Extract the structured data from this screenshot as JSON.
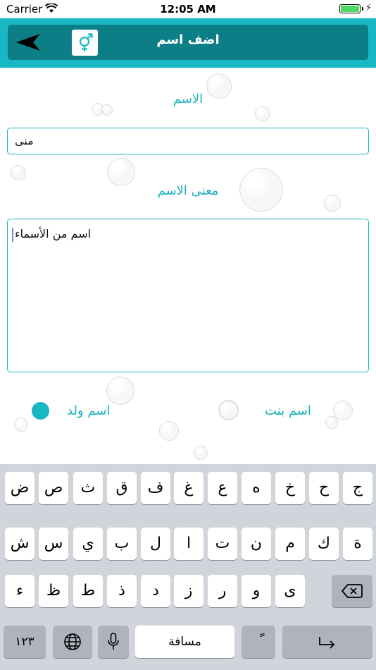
{
  "status": {
    "carrier": "Carrier",
    "time": "12:05 AM"
  },
  "header": {
    "title": "اضف اسم",
    "back_icon": "back-arrow-icon",
    "gender_icon": "gender-icon"
  },
  "form": {
    "name_label": "الاسم",
    "name_value": "منى",
    "meaning_label": "معنى الاسم",
    "meaning_value": "اسم من الأسماء",
    "girl_label": "اسم بنت",
    "boy_label": "اسم ولد",
    "selected": "boy",
    "accent": "#17b7c4"
  },
  "keyboard": {
    "row1": [
      "ض",
      "ص",
      "ث",
      "ق",
      "ف",
      "غ",
      "ع",
      "ه",
      "خ",
      "ح",
      "ج"
    ],
    "row2": [
      "ش",
      "س",
      "ي",
      "ب",
      "ل",
      "ا",
      "ت",
      "ن",
      "م",
      "ك",
      "ة"
    ],
    "row3": [
      "ء",
      "ظ",
      "ط",
      "ذ",
      "د",
      "ز",
      "ر",
      "و",
      "ى"
    ],
    "numbers_label": "١٢٣",
    "space_label": "مسافة",
    "diacritic_label": "ً"
  }
}
